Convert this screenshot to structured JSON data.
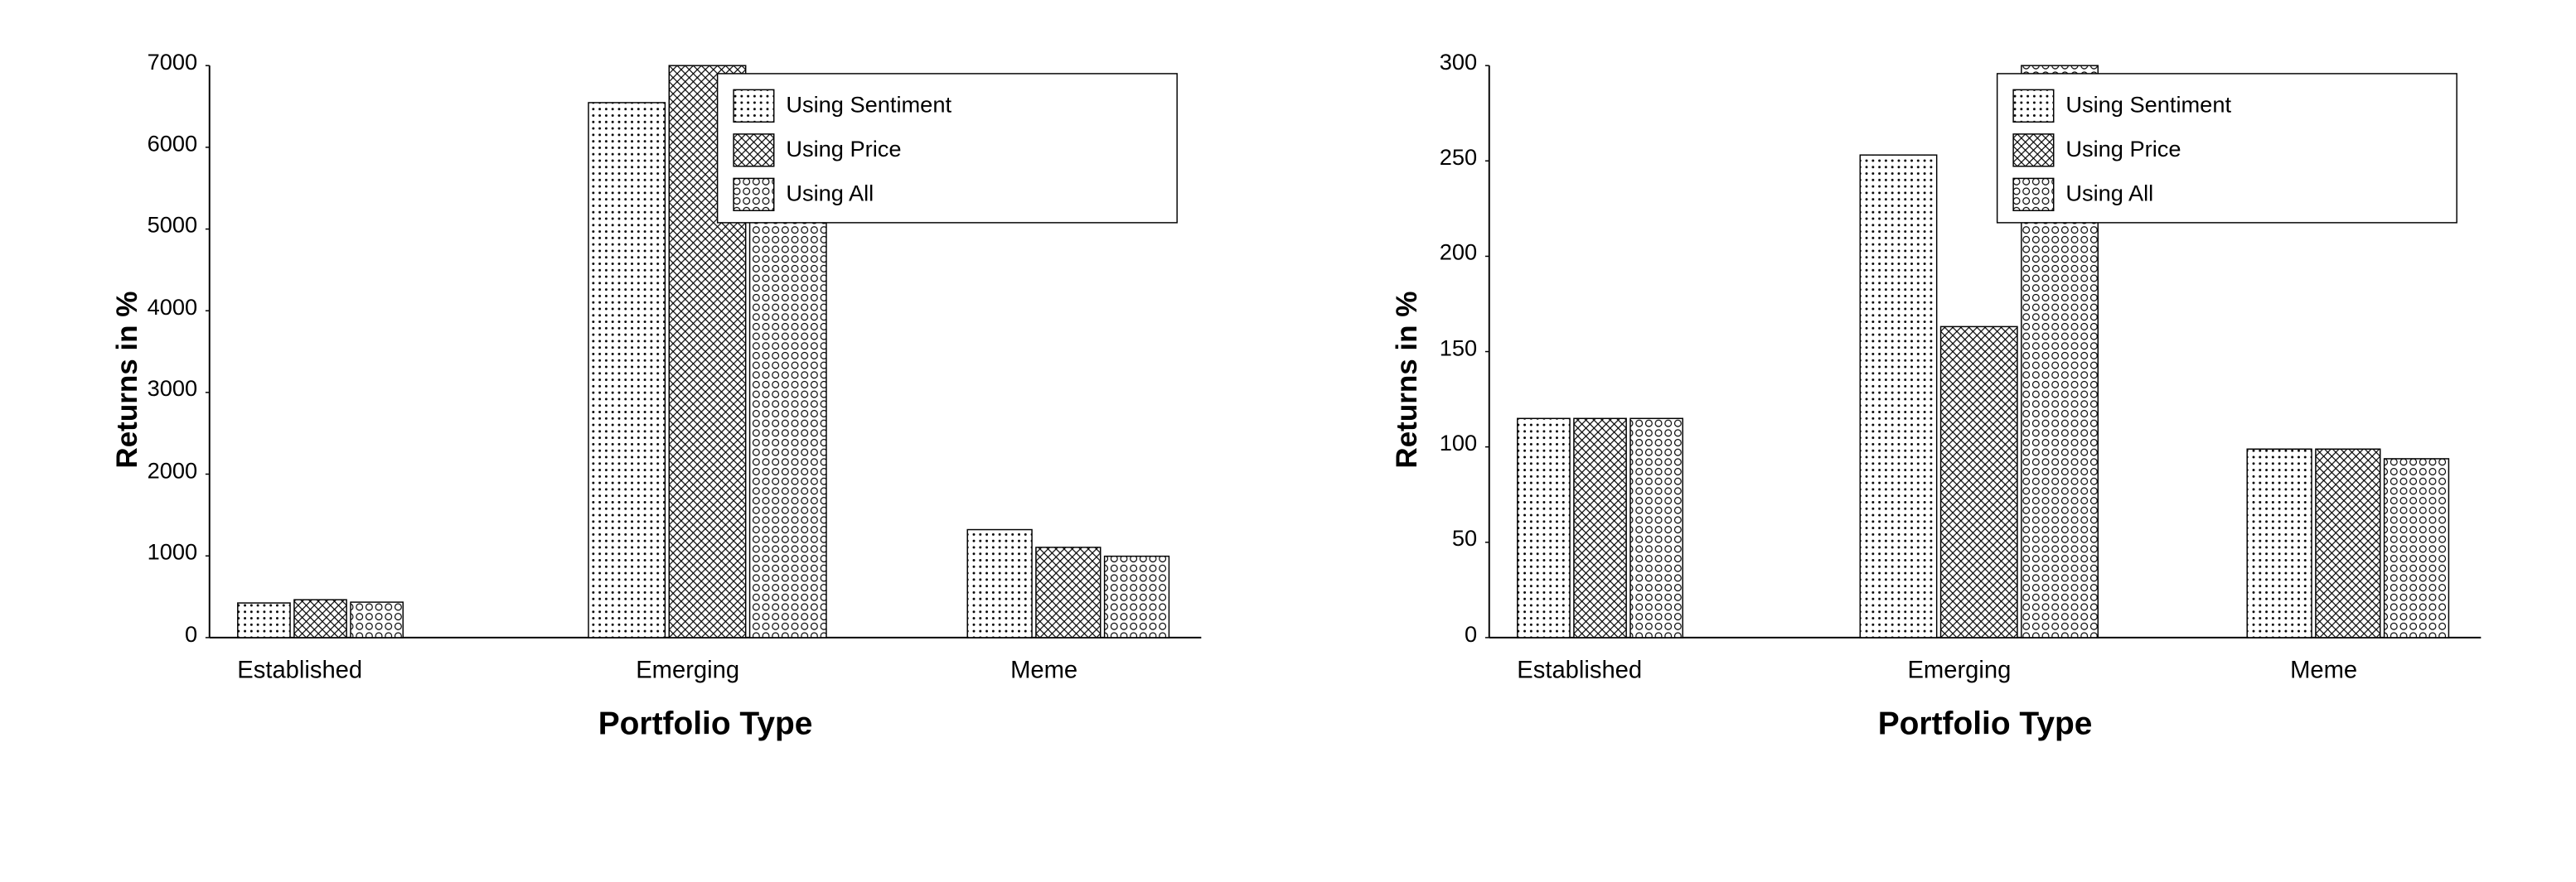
{
  "chart1": {
    "title": "",
    "y_label": "Returns in %",
    "x_label": "Portfolio Type",
    "y_max": 7000,
    "y_ticks": [
      0,
      1000,
      2000,
      3000,
      4000,
      5000,
      6000,
      7000
    ],
    "x_categories": [
      "Established",
      "Emerging",
      "Meme"
    ],
    "series": [
      {
        "name": "Using Sentiment",
        "pattern": "dots",
        "values": [
          420,
          6550,
          1320
        ]
      },
      {
        "name": "Using Price",
        "pattern": "hatch",
        "values": [
          460,
          7100,
          1100
        ]
      },
      {
        "name": "Using All",
        "pattern": "circles",
        "values": [
          430,
          5650,
          1000
        ]
      }
    ],
    "legend": {
      "items": [
        {
          "label": "Using Sentiment",
          "pattern": "dots"
        },
        {
          "label": "Using Price",
          "pattern": "hatch"
        },
        {
          "label": "Using All",
          "pattern": "circles"
        }
      ]
    }
  },
  "chart2": {
    "title": "",
    "y_label": "Returns in %",
    "x_label": "Portfolio Type",
    "y_max": 300,
    "y_ticks": [
      0,
      50,
      100,
      150,
      200,
      250,
      300
    ],
    "x_categories": [
      "Established",
      "Emerging",
      "Meme"
    ],
    "series": [
      {
        "name": "Using Sentiment",
        "pattern": "dots",
        "values": [
          115,
          253,
          99
        ]
      },
      {
        "name": "Using Price",
        "pattern": "hatch",
        "values": [
          115,
          163,
          99
        ]
      },
      {
        "name": "Using All",
        "pattern": "circles",
        "values": [
          115,
          308,
          94
        ]
      }
    ],
    "legend": {
      "items": [
        {
          "label": "Using Sentiment",
          "pattern": "dots"
        },
        {
          "label": "Using Price",
          "pattern": "hatch"
        },
        {
          "label": "Using All",
          "pattern": "circles"
        }
      ]
    }
  }
}
